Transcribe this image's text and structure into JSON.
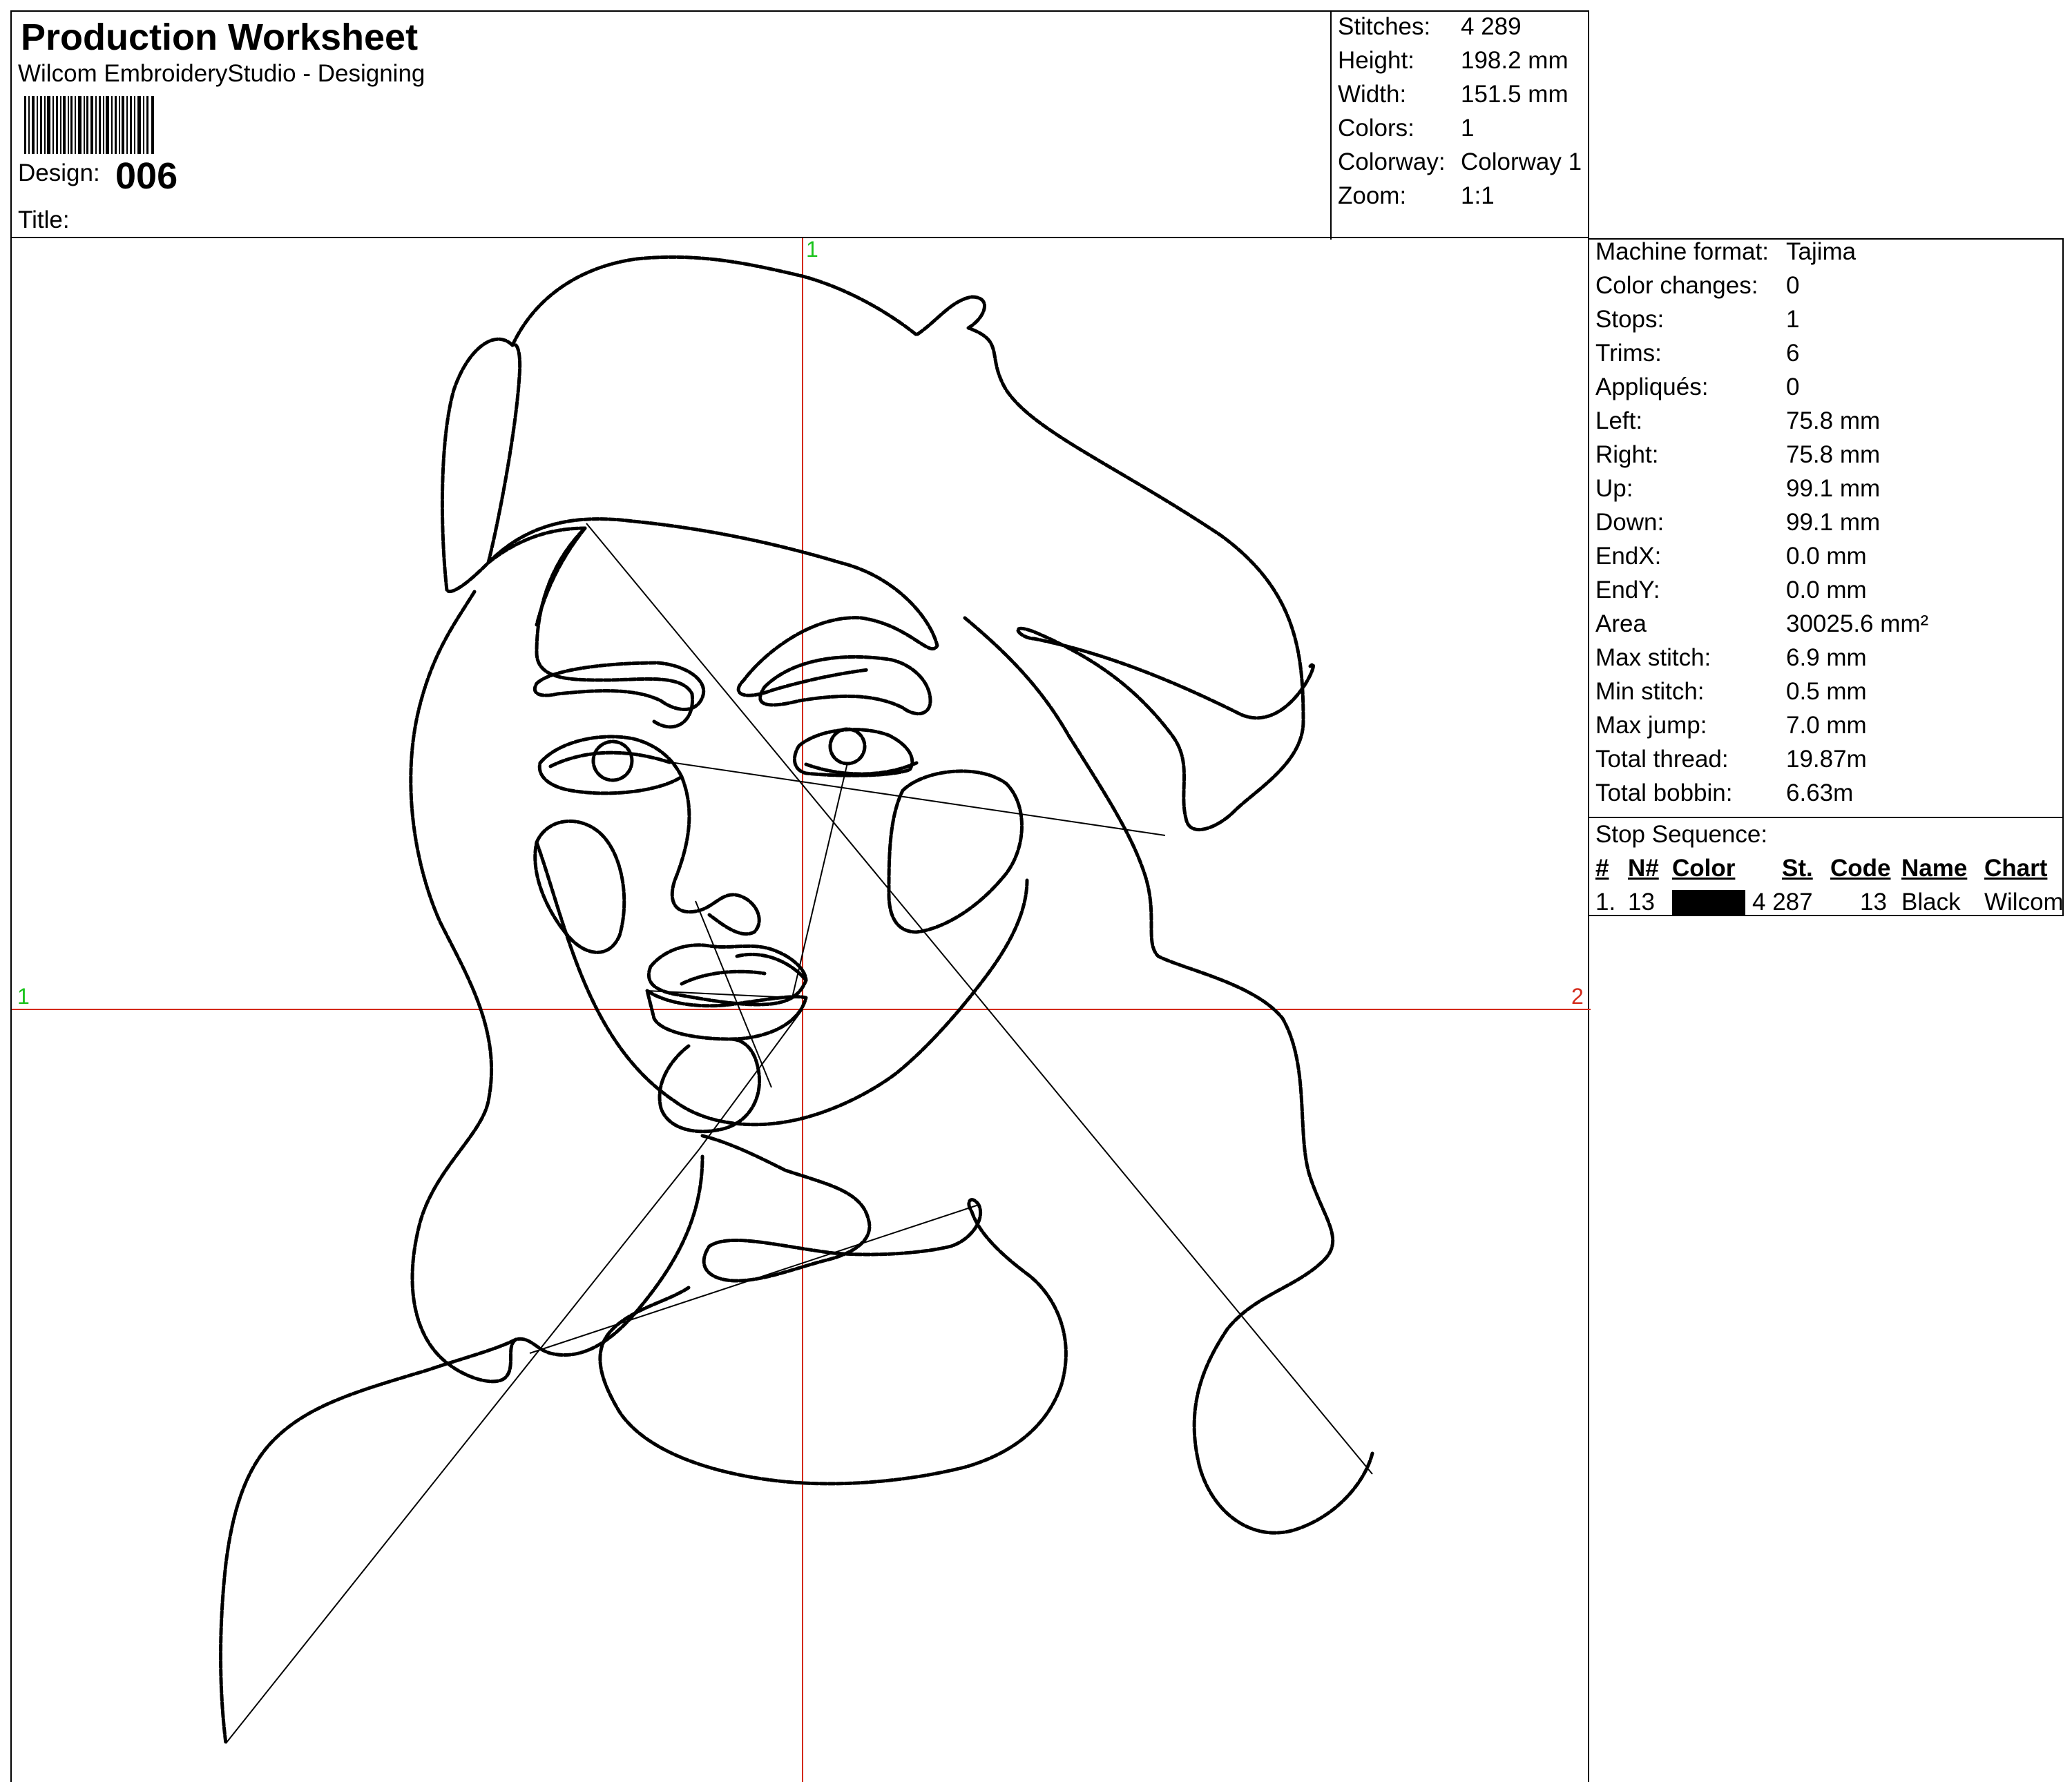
{
  "header": {
    "title": "Production Worksheet",
    "subtitle": "Wilcom EmbroideryStudio - Designing",
    "design_label": "Design:",
    "design_value": "006",
    "title_label": "Title:",
    "barcode_icon": "barcode-icon"
  },
  "stats": [
    {
      "label": "Stitches:",
      "value": "4 289"
    },
    {
      "label": "Height:",
      "value": "198.2 mm"
    },
    {
      "label": "Width:",
      "value": "151.5 mm"
    },
    {
      "label": "Colors:",
      "value": "1"
    },
    {
      "label": "Colorway:",
      "value": "Colorway 1"
    },
    {
      "label": "Zoom:",
      "value": "1:1"
    }
  ],
  "machine": [
    {
      "label": "Machine format:",
      "value": "Tajima"
    },
    {
      "label": "Color changes:",
      "value": "0"
    },
    {
      "label": "Stops:",
      "value": "1"
    },
    {
      "label": "Trims:",
      "value": "6"
    },
    {
      "label": "Appliqués:",
      "value": "0"
    },
    {
      "label": "Left:",
      "value": "75.8 mm"
    },
    {
      "label": "Right:",
      "value": "75.8 mm"
    },
    {
      "label": "Up:",
      "value": "99.1 mm"
    },
    {
      "label": "Down:",
      "value": "99.1 mm"
    },
    {
      "label": "EndX:",
      "value": "0.0 mm"
    },
    {
      "label": "EndY:",
      "value": "0.0 mm"
    },
    {
      "label": "Area",
      "value": "30025.6 mm²"
    },
    {
      "label": "Max stitch:",
      "value": "6.9 mm"
    },
    {
      "label": "Min stitch:",
      "value": "0.5 mm"
    },
    {
      "label": "Max jump:",
      "value": "7.0 mm"
    },
    {
      "label": "Total thread:",
      "value": "19.87m"
    },
    {
      "label": "Total bobbin:",
      "value": "6.63m"
    }
  ],
  "stop_sequence": {
    "title": "Stop Sequence:",
    "headers": [
      "#",
      "N#",
      "Color",
      "St.",
      "Code",
      "Name",
      "Chart"
    ],
    "rows": [
      {
        "index": "1.",
        "needle": "13",
        "color": "#000000",
        "stitches": "4 287",
        "code": "13",
        "name": "Black",
        "chart": "Wilcom"
      }
    ]
  },
  "canvas": {
    "axis_labels": {
      "top": "1",
      "left": "1",
      "right": "2"
    },
    "guide_color": "#d42a1a",
    "axis_label_colors": {
      "top": "#19c31b",
      "left": "#19c31b",
      "right": "#d42a1a"
    },
    "stitch_color": "#000000"
  }
}
